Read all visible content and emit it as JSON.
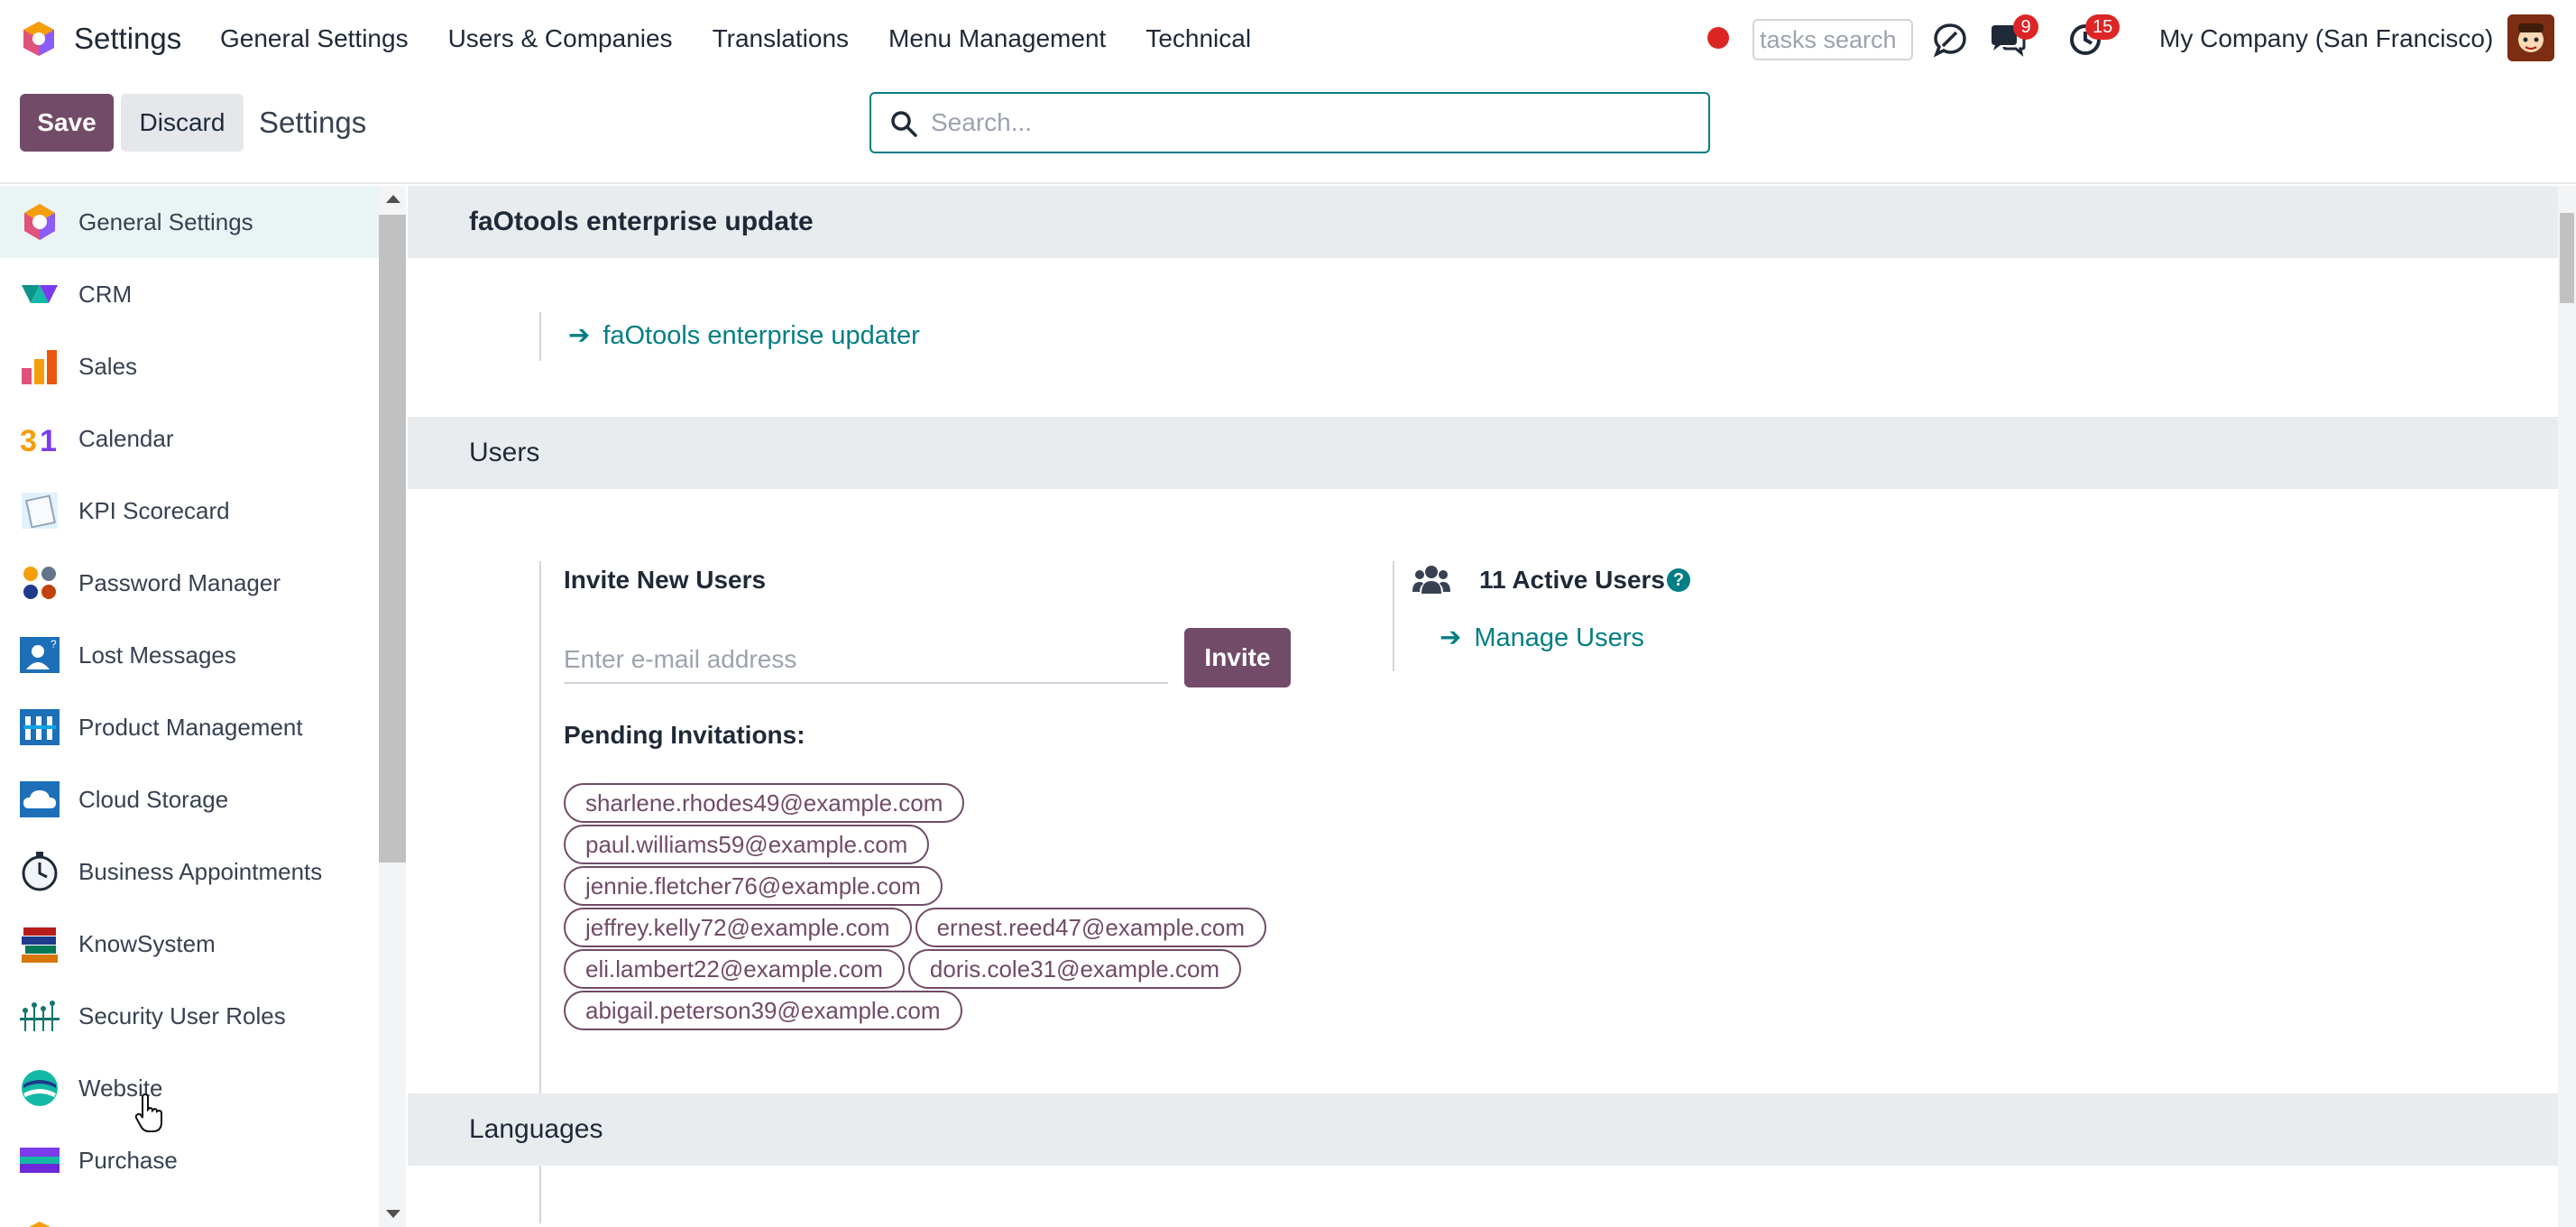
{
  "app": {
    "name": "Settings"
  },
  "topmenu": [
    "General Settings",
    "Users & Companies",
    "Translations",
    "Menu Management",
    "Technical"
  ],
  "systray": {
    "tasks_search_placeholder": "tasks search",
    "messages_count": "9",
    "activities_count": "15",
    "company": "My Company (San Francisco)"
  },
  "control": {
    "save_label": "Save",
    "discard_label": "Discard",
    "breadcrumb": "Settings",
    "search_placeholder": "Search..."
  },
  "sidebar": {
    "items": [
      {
        "label": "General Settings",
        "icon": "general-settings-icon",
        "active": true
      },
      {
        "label": "CRM",
        "icon": "crm-icon"
      },
      {
        "label": "Sales",
        "icon": "sales-icon"
      },
      {
        "label": "Calendar",
        "icon": "calendar-icon"
      },
      {
        "label": "KPI Scorecard",
        "icon": "kpi-scorecard-icon"
      },
      {
        "label": "Password Manager",
        "icon": "password-manager-icon"
      },
      {
        "label": "Lost Messages",
        "icon": "lost-messages-icon"
      },
      {
        "label": "Product Management",
        "icon": "product-management-icon"
      },
      {
        "label": "Cloud Storage",
        "icon": "cloud-storage-icon"
      },
      {
        "label": "Business Appointments",
        "icon": "business-appointments-icon"
      },
      {
        "label": "KnowSystem",
        "icon": "knowsystem-icon"
      },
      {
        "label": "Security User Roles",
        "icon": "security-user-roles-icon"
      },
      {
        "label": "Website",
        "icon": "website-icon"
      },
      {
        "label": "Purchase",
        "icon": "purchase-icon"
      }
    ]
  },
  "sections": {
    "faotools": {
      "title": "faOtools enterprise update",
      "link": "faOtools enterprise updater"
    },
    "users": {
      "title": "Users",
      "invite_title": "Invite New Users",
      "email_placeholder": "Enter e-mail address",
      "invite_button": "Invite",
      "pending_title": "Pending Invitations:",
      "pending_rows": [
        [
          "sharlene.rhodes49@example.com"
        ],
        [
          "paul.williams59@example.com"
        ],
        [
          "jennie.fletcher76@example.com"
        ],
        [
          "jeffrey.kelly72@example.com",
          "ernest.reed47@example.com"
        ],
        [
          "eli.lambert22@example.com",
          "doris.cole31@example.com"
        ],
        [
          "abigail.peterson39@example.com"
        ]
      ],
      "active_users": "11 Active Users",
      "help_glyph": "?",
      "manage_link": "Manage Users"
    },
    "languages": {
      "title": "Languages"
    }
  },
  "colors": {
    "brand": "#714B67",
    "accent": "#017e84",
    "badge": "#dc2626"
  }
}
